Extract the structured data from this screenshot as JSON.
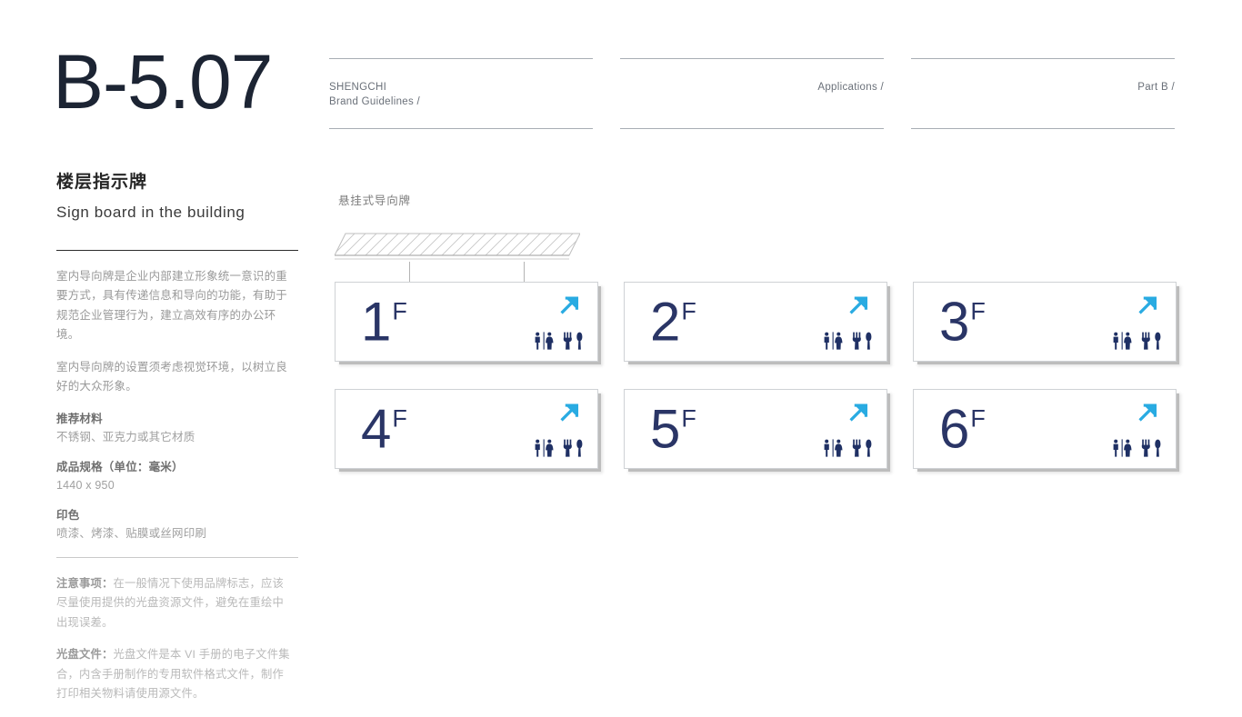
{
  "sidebar": {
    "page_code": "B-5.07",
    "title_cn": "楼层指示牌",
    "title_en": "Sign board in the building",
    "paragraphs": [
      "室内导向牌是企业内部建立形象统一意识的重要方式，具有传递信息和导向的功能，有助于规范企业管理行为，建立高效有序的办公环境。",
      "室内导向牌的设置须考虑视觉环境，以树立良好的大众形象。"
    ],
    "specs": [
      {
        "label": "推荐材料",
        "value": "不锈钢、亚克力或其它材质"
      },
      {
        "label": "成品规格（单位：毫米）",
        "value": "1440 x 950"
      },
      {
        "label": "印色",
        "value": "喷漆、烤漆、贴膜或丝网印刷"
      }
    ],
    "notes": [
      {
        "label": "注意事项：",
        "text": "在一般情况下使用品牌标志，应该尽量使用提供的光盘资源文件，避免在重绘中出现误差。"
      },
      {
        "label": "光盘文件：",
        "text": "光盘文件是本 VI 手册的电子文件集合，内含手册制作的专用软件格式文件，制作打印相关物料请使用源文件。"
      }
    ]
  },
  "header": {
    "left_line1": "SHENGCHI",
    "left_line2": "Brand Guidelines /",
    "middle": "Applications /",
    "right": "Part B /"
  },
  "main": {
    "section_caption": "悬挂式导向牌",
    "panels": [
      {
        "floor": "1",
        "suffix": "F",
        "icons": [
          "arrow-northeast-icon",
          "restroom-icon",
          "restaurant-icon"
        ]
      },
      {
        "floor": "2",
        "suffix": "F",
        "icons": [
          "arrow-northeast-icon",
          "restroom-icon",
          "restaurant-icon"
        ]
      },
      {
        "floor": "3",
        "suffix": "F",
        "icons": [
          "arrow-northeast-icon",
          "restroom-icon",
          "restaurant-icon"
        ]
      },
      {
        "floor": "4",
        "suffix": "F",
        "icons": [
          "arrow-northeast-icon",
          "restroom-icon",
          "restaurant-icon"
        ]
      },
      {
        "floor": "5",
        "suffix": "F",
        "icons": [
          "arrow-northeast-icon",
          "restroom-icon",
          "restaurant-icon"
        ]
      },
      {
        "floor": "6",
        "suffix": "F",
        "icons": [
          "arrow-northeast-icon",
          "restroom-icon",
          "restaurant-icon"
        ]
      }
    ]
  },
  "colors": {
    "navy": "#2a3566",
    "cyan": "#29abe2",
    "page_code": "#1c2433",
    "body_text": "#999999",
    "rule_dark": "#2b2b2b",
    "rule_light": "#c9c9c9",
    "panel_border": "#cfd2d5"
  }
}
